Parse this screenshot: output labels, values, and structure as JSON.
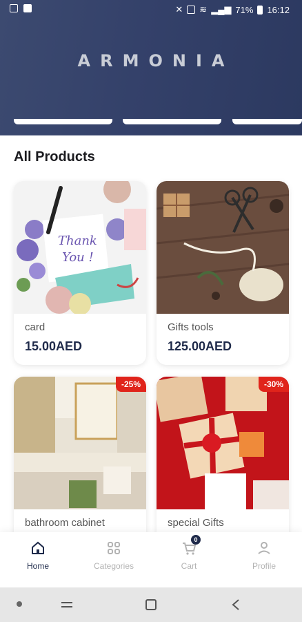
{
  "status_bar": {
    "battery": "71%",
    "time": "16:12"
  },
  "header": {
    "brand": "ARMONIA"
  },
  "section_title": "All Products",
  "products": [
    {
      "name": "card",
      "price": "15.00AED",
      "badge": ""
    },
    {
      "name": "Gifts tools",
      "price": "125.00AED",
      "badge": ""
    },
    {
      "name": "bathroom cabinet",
      "price": "",
      "badge": "-25%"
    },
    {
      "name": "special Gifts",
      "price": "",
      "badge": "-30%"
    }
  ],
  "bottom_nav": [
    {
      "label": "Home",
      "active": true,
      "icon": "home-icon"
    },
    {
      "label": "Categories",
      "active": false,
      "icon": "grid-icon"
    },
    {
      "label": "Cart",
      "active": false,
      "icon": "cart-icon",
      "count": "0"
    },
    {
      "label": "Profile",
      "active": false,
      "icon": "user-icon"
    }
  ],
  "colors": {
    "header": "#34416a",
    "accent": "#1f2a4a",
    "badge": "#e0241b"
  }
}
